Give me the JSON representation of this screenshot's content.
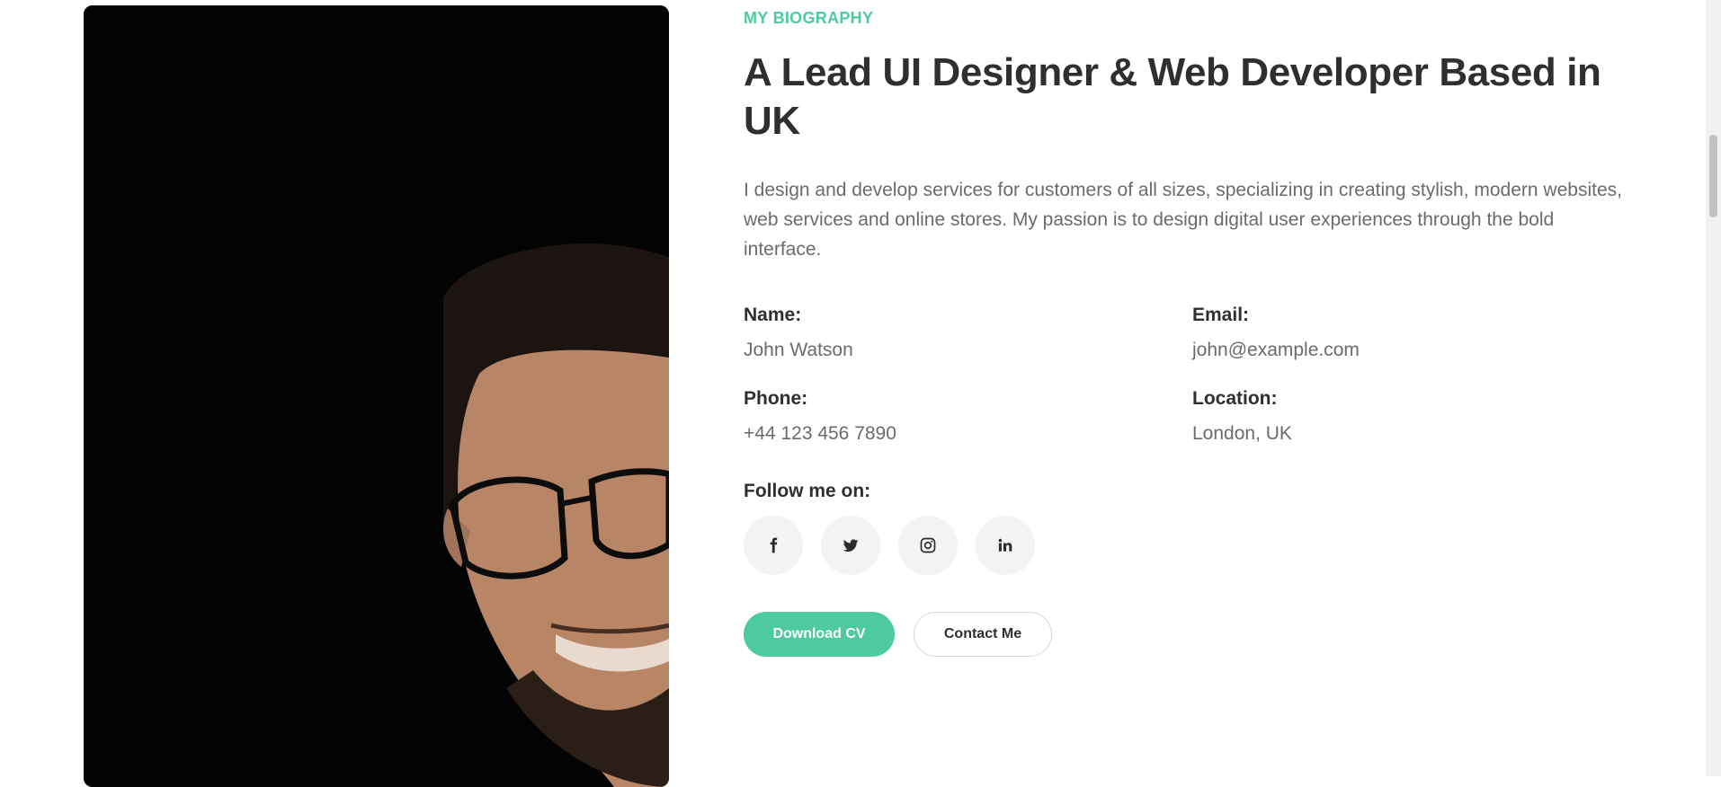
{
  "section": {
    "eyebrow": "MY BIOGRAPHY",
    "headline": "A Lead UI Designer & Web Developer Based in UK",
    "description": "I design and develop services for customers of all sizes, specializing in creating stylish, modern websites, web services and online stores. My passion is to design digital user experiences through the bold interface."
  },
  "info": {
    "name_label": "Name:",
    "name_value": "John Watson",
    "email_label": "Email:",
    "email_value": "john@example.com",
    "phone_label": "Phone:",
    "phone_value": "+44 123 456 7890",
    "location_label": "Location:",
    "location_value": "London, UK"
  },
  "follow": {
    "label": "Follow me on:",
    "icons": [
      "facebook-icon",
      "twitter-icon",
      "instagram-icon",
      "linkedin-icon"
    ]
  },
  "buttons": {
    "download": "Download CV",
    "contact": "Contact Me"
  },
  "colors": {
    "accent": "#4ecb9e",
    "heading": "#2f2f2f",
    "body_text": "#6b6b6b",
    "social_bg": "#f3f3f3"
  }
}
